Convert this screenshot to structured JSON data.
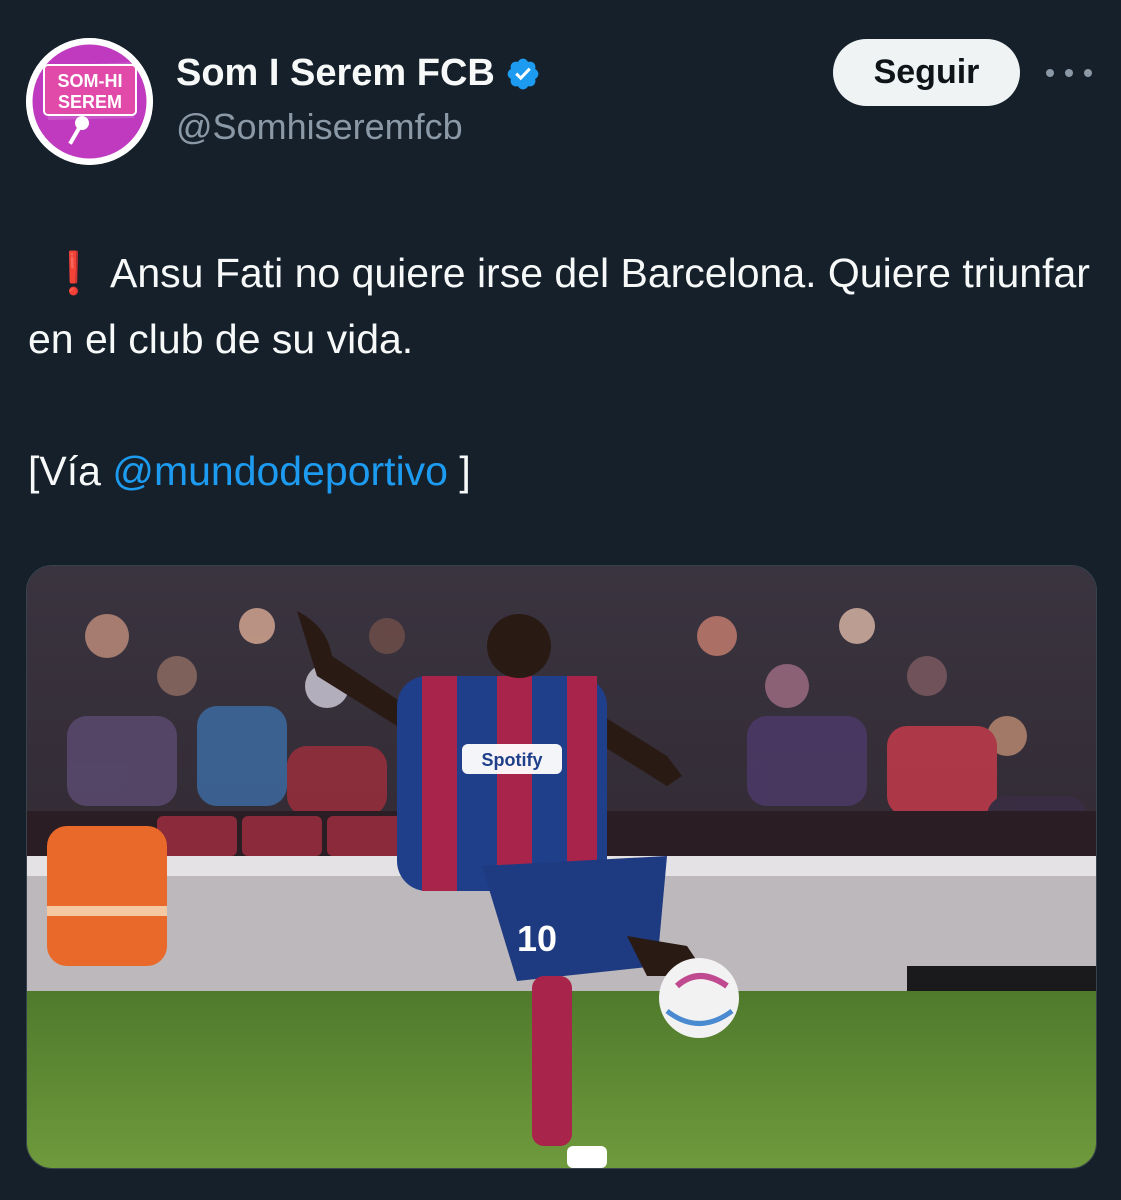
{
  "tweet": {
    "display_name": "Som I Serem FCB",
    "handle": "@Somhiseremfcb",
    "follow_label": "Seguir",
    "more_icon": "more-dots-icon",
    "verified_icon": "verified-badge-icon",
    "avatar": {
      "line1": "SOM-HI",
      "line2": "SEREM"
    },
    "text_line1": "Ansu Fati no quiere irse del Barcelona. Quiere triunfar en el club de su vida.",
    "emoji": "❗",
    "via_prefix": "[Vía ",
    "via_mention": "@mundodeportivo",
    "via_suffix": " ]",
    "media": {
      "kit_sponsor": "Spotify",
      "shirt_number": "10"
    }
  },
  "colors": {
    "background": "#15202b",
    "text": "#f7f9f9",
    "secondary": "#8b98a5",
    "link": "#1d9bf0",
    "verified": "#1d9bf0",
    "follow_bg": "#eff3f4"
  }
}
